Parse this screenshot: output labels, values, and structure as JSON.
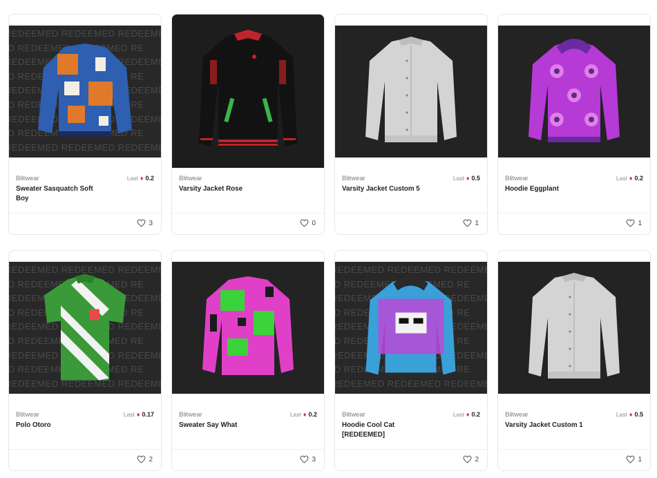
{
  "watermark_text": "REDEEMED REDEEMED REDEEMED REDEEMED",
  "last_label": "Last",
  "currency_icon": "eth-diamond-icon",
  "colors": {
    "accent": "#e0245e",
    "card_border": "#e7e7e7",
    "art_bg": "#282828"
  },
  "cards": [
    {
      "brand": "Blitwear",
      "name": "Sweater Sasquatch Soft Boy",
      "price": "0.2",
      "likes": "3",
      "redeemed_art": true
    },
    {
      "brand": "Blitwear",
      "name": "Varsity Jacket Rose",
      "price": "",
      "likes": "0",
      "redeemed_art": false
    },
    {
      "brand": "Blitwear",
      "name": "Varsity Jacket Custom 5",
      "price": "0.5",
      "likes": "1",
      "redeemed_art": false
    },
    {
      "brand": "Blitwear",
      "name": "Hoodie Eggplant",
      "price": "0.2",
      "likes": "1",
      "redeemed_art": false
    },
    {
      "brand": "Blitwear",
      "name": "Polo Otoro",
      "price": "0.17",
      "likes": "2",
      "redeemed_art": true
    },
    {
      "brand": "Blitwear",
      "name": "Sweater Say What",
      "price": "0.2",
      "likes": "3",
      "redeemed_art": false
    },
    {
      "brand": "Blitwear",
      "name": "Hoodie Cool Cat [REDEEMED]",
      "price": "0.2",
      "likes": "2",
      "redeemed_art": true
    },
    {
      "brand": "Blitwear",
      "name": "Varsity Jacket Custom 1",
      "price": "0.5",
      "likes": "1",
      "redeemed_art": false
    }
  ]
}
